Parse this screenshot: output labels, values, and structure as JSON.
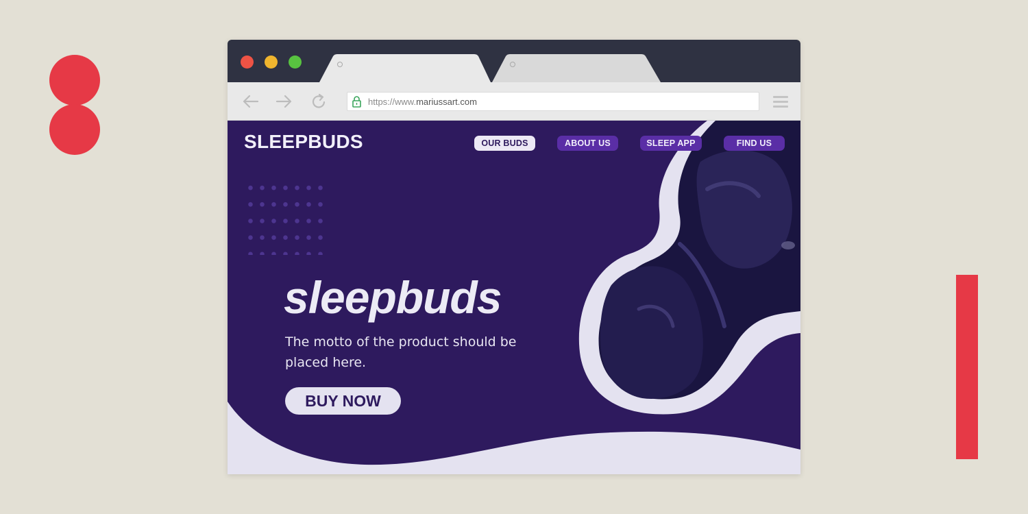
{
  "browser": {
    "tabs": [
      {
        "label": ""
      },
      {
        "label": ""
      }
    ],
    "url": {
      "prefix": "https://www.",
      "domain": "mariussart.com"
    }
  },
  "site": {
    "logo": "SLEEPBUDS",
    "nav": [
      {
        "label": "OUR BUDS",
        "active": true
      },
      {
        "label": "ABOUT US",
        "active": false
      },
      {
        "label": "SLEEP APP",
        "active": false
      },
      {
        "label": "FIND US",
        "active": false
      }
    ],
    "hero": {
      "title": "sleepbuds",
      "motto": "The motto of the product should be placed here.",
      "cta": "BUY NOW"
    }
  },
  "colors": {
    "page_background": "#e3e0d5",
    "accent_red": "#e63946",
    "site_background": "#2e1a5e",
    "nav_button": "#5a2ea6",
    "light": "#e4e2f0"
  }
}
